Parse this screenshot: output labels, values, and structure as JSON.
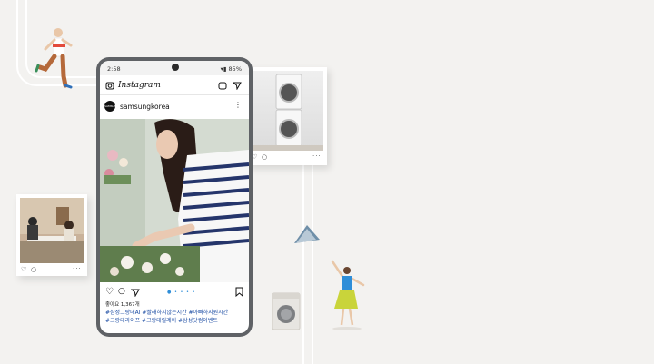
{
  "status_bar": {
    "time": "2:58",
    "battery": "85%"
  },
  "instagram": {
    "app_name": "Instagram",
    "username": "samsungkorea",
    "avatar_text": "SAMSUNG",
    "likes": "좋아요 1,367개",
    "hashtags_line1": "#삼성그랑데AI #빨래하지않는시간 #아빠하지원시간",
    "hashtags_line2": "#그랑데라이프 #그랑데릴레이 #삼성닷컴이벤트"
  },
  "cards": {
    "washer_dots": "···",
    "cafe_dots": "···"
  },
  "colors": {
    "background": "#f3f2f0",
    "phone_frame": "#5f6266",
    "hashtag_blue": "#1b4ca3",
    "person_blue": "#2f8ed8",
    "skirt_yellow": "#c9d43a"
  }
}
